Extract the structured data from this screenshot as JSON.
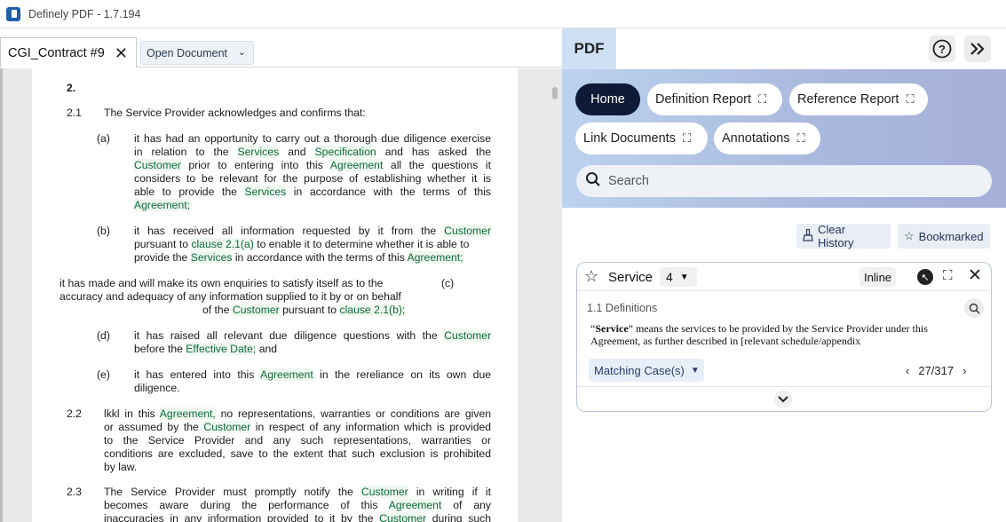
{
  "app": {
    "title": "Definely PDF - 1.7.194"
  },
  "left": {
    "tab_label": "CGI_Contract #9",
    "open_document_label": "Open Document",
    "doc": {
      "heading": "2.",
      "c21_num": "2.1",
      "c21_text": "The Service Provider acknowledges and confirms that:",
      "a_label": "(a)",
      "a_l1": "it has had an opportunity to carry out a thorough due diligence exercise",
      "a_l2_1": "in relation to the",
      "a_l2_services": "Services",
      "a_l2_2": "and",
      "a_l2_spec": "Specification",
      "a_l2_3": "and has asked the",
      "a_l3_customer": "Customer",
      "a_l3_1": "prior to entering into this",
      "a_l3_agreement": "Agreement",
      "a_l3_2": "all the questions it",
      "a_l4": "considers to be relevant for the purpose of establishing whether it is",
      "a_l5_1": "able to provide the",
      "a_l5_services": "Services",
      "a_l5_2": "in accordance with the terms of this",
      "a_l6_agreement": "Agreement;",
      "b_label": "(b)",
      "b_l1_1": "it has received all information requested by it from the",
      "b_l1_customer": "Customer",
      "b_l2_1": "pursuant to",
      "b_l2_clause": "clause 2.1(a)",
      "b_l2_2": " to enable it to determine whether it is able to",
      "b_l3_1": "provide the",
      "b_l3_services": "Services",
      "b_l3_2": "in accordance with the terms of this",
      "b_l3_agreement": "Agreement;",
      "c_l1": "it has made and will make its own enquiries to satisfy itself as to the",
      "c_label": "(c)",
      "c_l2": "accuracy and adequacy of any information supplied to it by or on behalf",
      "c_l3_1": "of the",
      "c_l3_customer": "Customer",
      "c_l3_2": "pursuant to",
      "c_l3_clause": "clause 2.1(b);",
      "d_label": "(d)",
      "d_l1_1": "it has raised all relevant due diligence questions with the",
      "d_l1_customer": "Customer",
      "d_l2_1": "before the",
      "d_l2_date": "Effective Date;",
      "d_l2_2": "and",
      "e_label": "(e)",
      "e_l1_1": "it has entered into this",
      "e_l1_agreement": "Agreement",
      "e_l1_2": "in the rereliance on its own due",
      "e_l2": "diligence.",
      "c22_num": "2.2",
      "c22_l1_1": "lkkl in this",
      "c22_l1_agreement": "Agreement,",
      "c22_l1_2": "no representations, warranties or conditions are given",
      "c22_l2_1": "or assumed by the",
      "c22_l2_customer": "Customer",
      "c22_l2_2": "in respect of any information which is provided",
      "c22_l3": "to the Service Provider and any such representations, warranties or",
      "c22_l4": "conditions are excluded, save to the extent that such exclusion is prohibited",
      "c22_l5": "by law.",
      "c23_num": "2.3",
      "c23_l1_1": "The Service Provider must promptly notify the",
      "c23_l1_customer": "Customer",
      "c23_l1_2": "in writing if it",
      "c23_l2_1": "becomes aware during the performance of this",
      "c23_l2_agreement": "Agreement",
      "c23_l2_2": "of any",
      "c23_l3_1": "inaccuracies in any information provided to it by the",
      "c23_l3_customer": "Customer",
      "c23_l3_2": "during such"
    }
  },
  "right": {
    "pdf_tab": "PDF",
    "nav": {
      "home": "Home",
      "definition_report": "Definition Report",
      "reference_report": "Reference Report",
      "link_documents": "Link Documents",
      "annotations": "Annotations"
    },
    "search_placeholder": "Search",
    "clear_history": "Clear History",
    "bookmarked": "Bookmarked",
    "card": {
      "term": "Service",
      "count": "4",
      "inline": "Inline",
      "section": "1.1 Definitions",
      "def_quote_open": "“",
      "def_term": "Service",
      "def_rest": "” means the services to be provided by the Service Provider under this Agreement, as further described in [relevant schedule/appendix",
      "matching": "Matching Case(s)",
      "pager": "27/317"
    }
  },
  "icons": {
    "help": "help-circle-icon",
    "collapse": "double-chevron-right-icon",
    "expand": "expand-icon",
    "search": "search-icon"
  }
}
